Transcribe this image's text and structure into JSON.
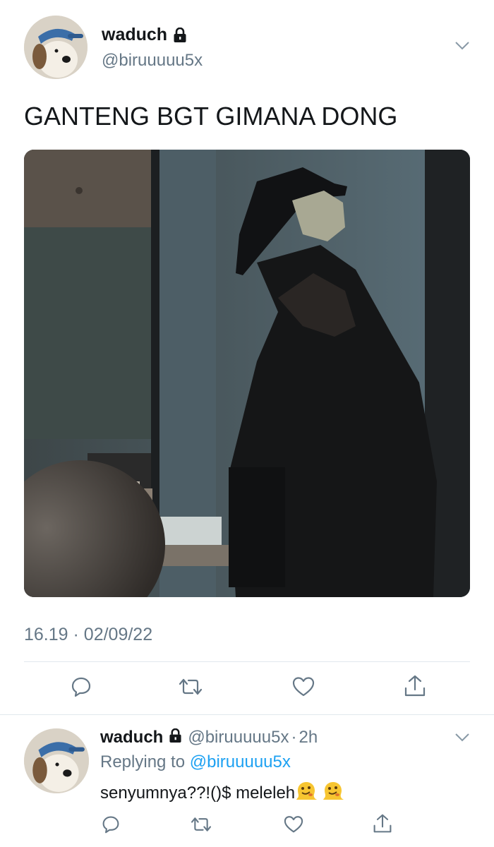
{
  "tweet": {
    "author_name": "waduch",
    "author_handle": "@biruuuuu5x",
    "text": "GANTENG BGT GIMANA DONG",
    "time": "16.19",
    "separator": "·",
    "date": "02/09/22",
    "actions": [
      "reply",
      "retweet",
      "like",
      "share"
    ]
  },
  "reply": {
    "author_name": "waduch",
    "author_handle": "@biruuuuu5x",
    "separator": "·",
    "age": "2h",
    "replying_prefix": "Replying to",
    "replying_handle": "@biruuuuu5x",
    "text": "senyumnya??!()$ meleleh",
    "emojis": [
      "melting-face",
      "melting-face"
    ]
  },
  "colors": {
    "text": "#14171a",
    "secondary": "#657786",
    "accent": "#1da1f2",
    "icon": "#657786",
    "divider": "#e1e8ed"
  }
}
